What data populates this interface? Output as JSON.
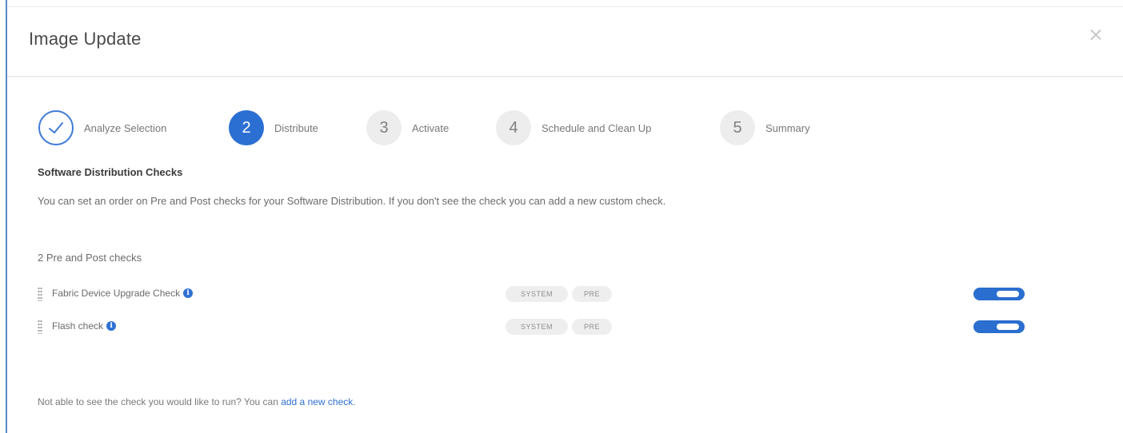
{
  "dialog": {
    "title": "Image Update",
    "close_icon": "close-icon"
  },
  "stepper": {
    "steps": [
      {
        "number": "",
        "label": "Analyze Selection",
        "state": "completed",
        "icon": "checkmark-icon"
      },
      {
        "number": "2",
        "label": "Distribute",
        "state": "active"
      },
      {
        "number": "3",
        "label": "Activate",
        "state": "pending"
      },
      {
        "number": "4",
        "label": "Schedule and Clean Up",
        "state": "pending"
      },
      {
        "number": "5",
        "label": "Summary",
        "state": "pending"
      }
    ]
  },
  "section": {
    "title": "Software Distribution Checks",
    "description": "You can set an order on Pre and Post checks for your Software Distribution. If you don't see the check you can add a new custom check."
  },
  "checks": {
    "count_label": "2 Pre and Post checks",
    "items": [
      {
        "name": "Fabric Device Upgrade Check",
        "tags": [
          "SYSTEM",
          "PRE"
        ],
        "enabled": true
      },
      {
        "name": "Flash check",
        "tags": [
          "SYSTEM",
          "PRE"
        ],
        "enabled": true
      }
    ]
  },
  "footer": {
    "prompt": "Not able to see the check you would like to run? You can ",
    "link": "add a new check",
    "suffix": "."
  },
  "colors": {
    "accent": "#2b6fd2",
    "left_rail": "#5b88c6",
    "pending_circle": "#ededed",
    "tag_bg": "#eeeeee"
  }
}
